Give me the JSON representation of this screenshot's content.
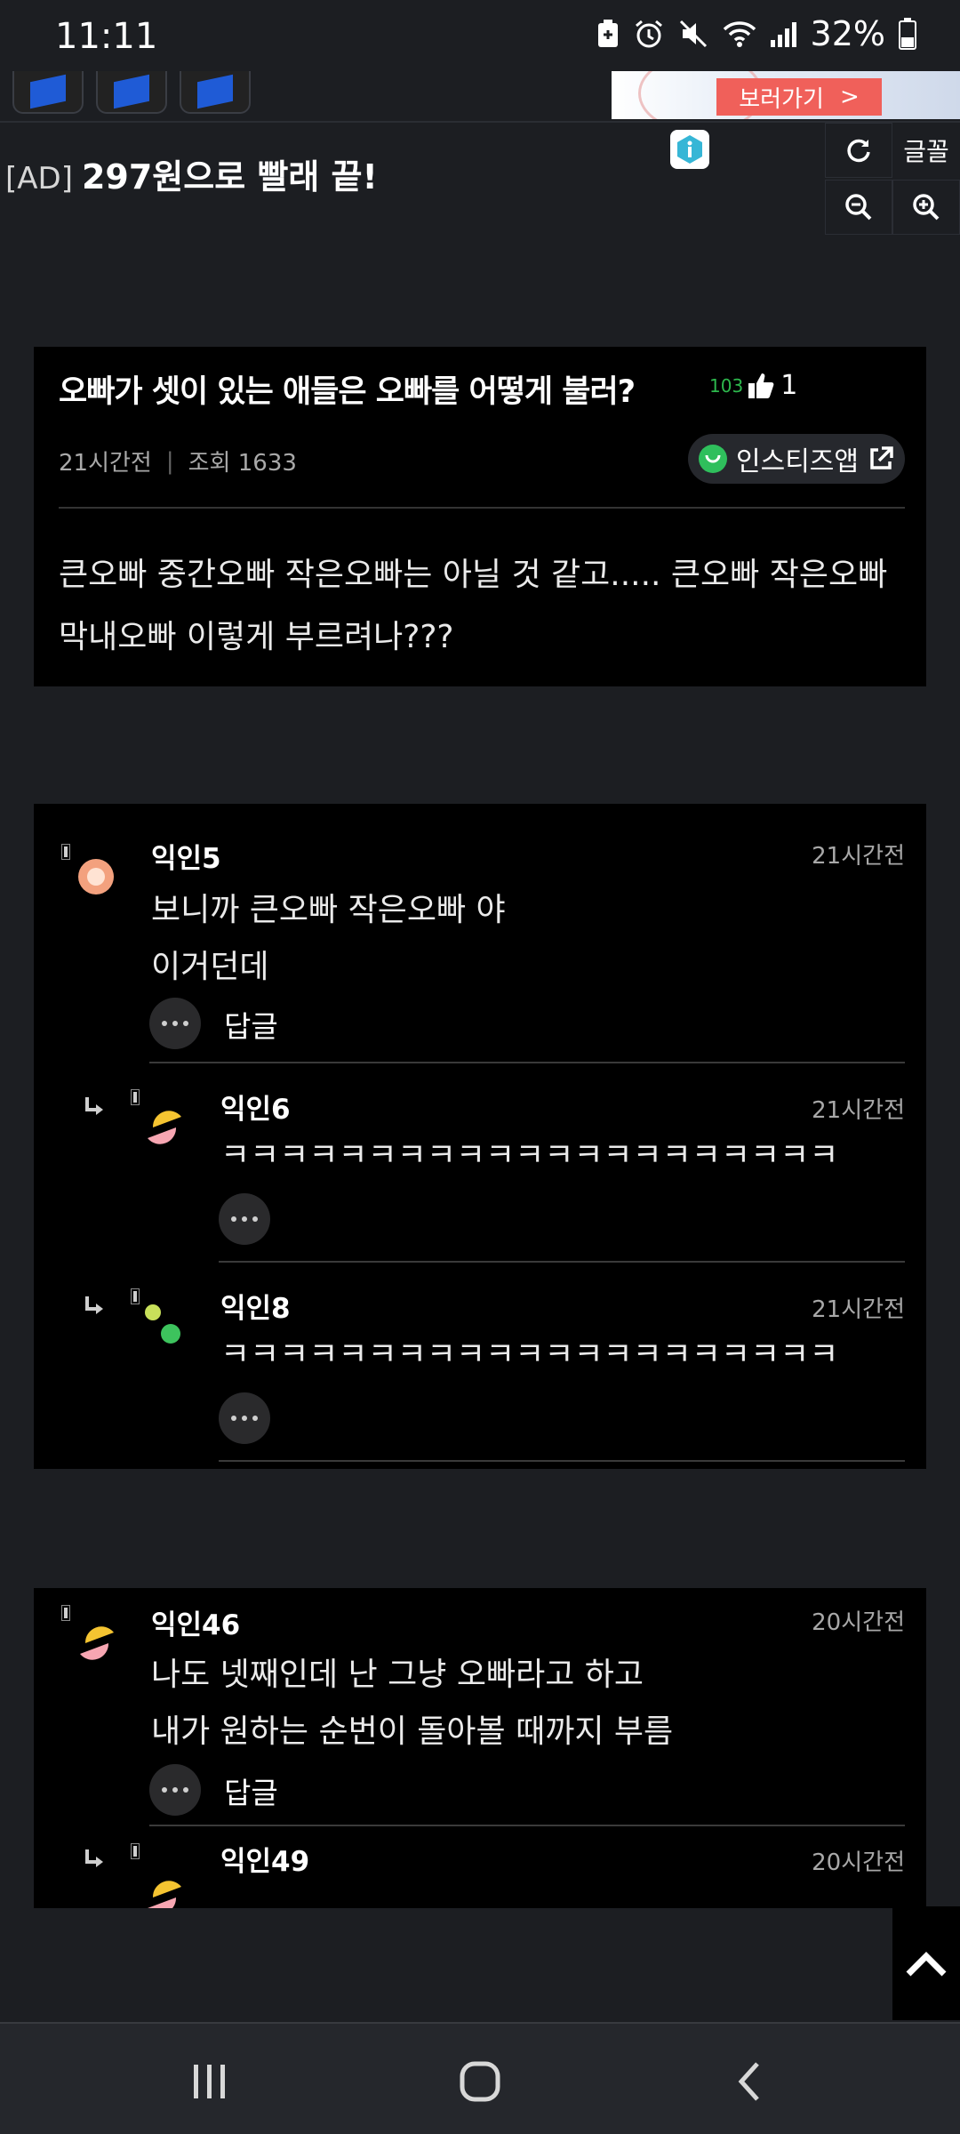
{
  "status_bar": {
    "time": "11:11",
    "battery": "32%"
  },
  "ad": {
    "banner_button": "보러가기",
    "banner_arrow": ">",
    "tag": "[AD]",
    "text": "297원으로 빨래 끝!"
  },
  "tools": {
    "font_label": "글꼴"
  },
  "post": {
    "title": "오빠가 셋이 있는 애들은 오빠를 어떻게 불러?",
    "comment_count": "103",
    "like_count": "1",
    "time": "21시간전",
    "views": "조회 1633",
    "app_label": "인스티즈앱",
    "body": "큰오빠 중간오빠 작은오빠는 아닐 것 같고..... 큰오빠 작은오빠 막내오빠 이렇게 부르려나???"
  },
  "comments": [
    {
      "name": "익인5",
      "time": "21시간전",
      "lines": [
        "보니까 큰오빠 작은오빠 야",
        "이거던데"
      ],
      "reply_label": "답글",
      "avatar_color": "#f3a17e"
    },
    {
      "name": "익인6",
      "time": "21시간전",
      "lines": [
        "ㅋㅋㅋㅋㅋㅋㅋㅋㅋㅋㅋㅋㅋㅋㅋㅋㅋㅋㅋㅋㅋ"
      ],
      "avatar_color": "#f5c431"
    },
    {
      "name": "익인8",
      "time": "21시간전",
      "lines": [
        "ㅋㅋㅋㅋㅋㅋㅋㅋㅋㅋㅋㅋㅋㅋㅋㅋㅋㅋㅋㅋㅋ"
      ],
      "avatar_color": "#3dc35d"
    },
    {
      "name": "익인46",
      "time": "20시간전",
      "lines": [
        "나도 넷째인데 난 그냥 오빠라고 하고",
        "내가 원하는 순번이 돌아볼 때까지 부름"
      ],
      "reply_label": "답글",
      "avatar_color": "#f5c431"
    },
    {
      "name": "익인49",
      "time": "20시간전",
      "lines": [],
      "avatar_color": "#f5c431"
    }
  ]
}
